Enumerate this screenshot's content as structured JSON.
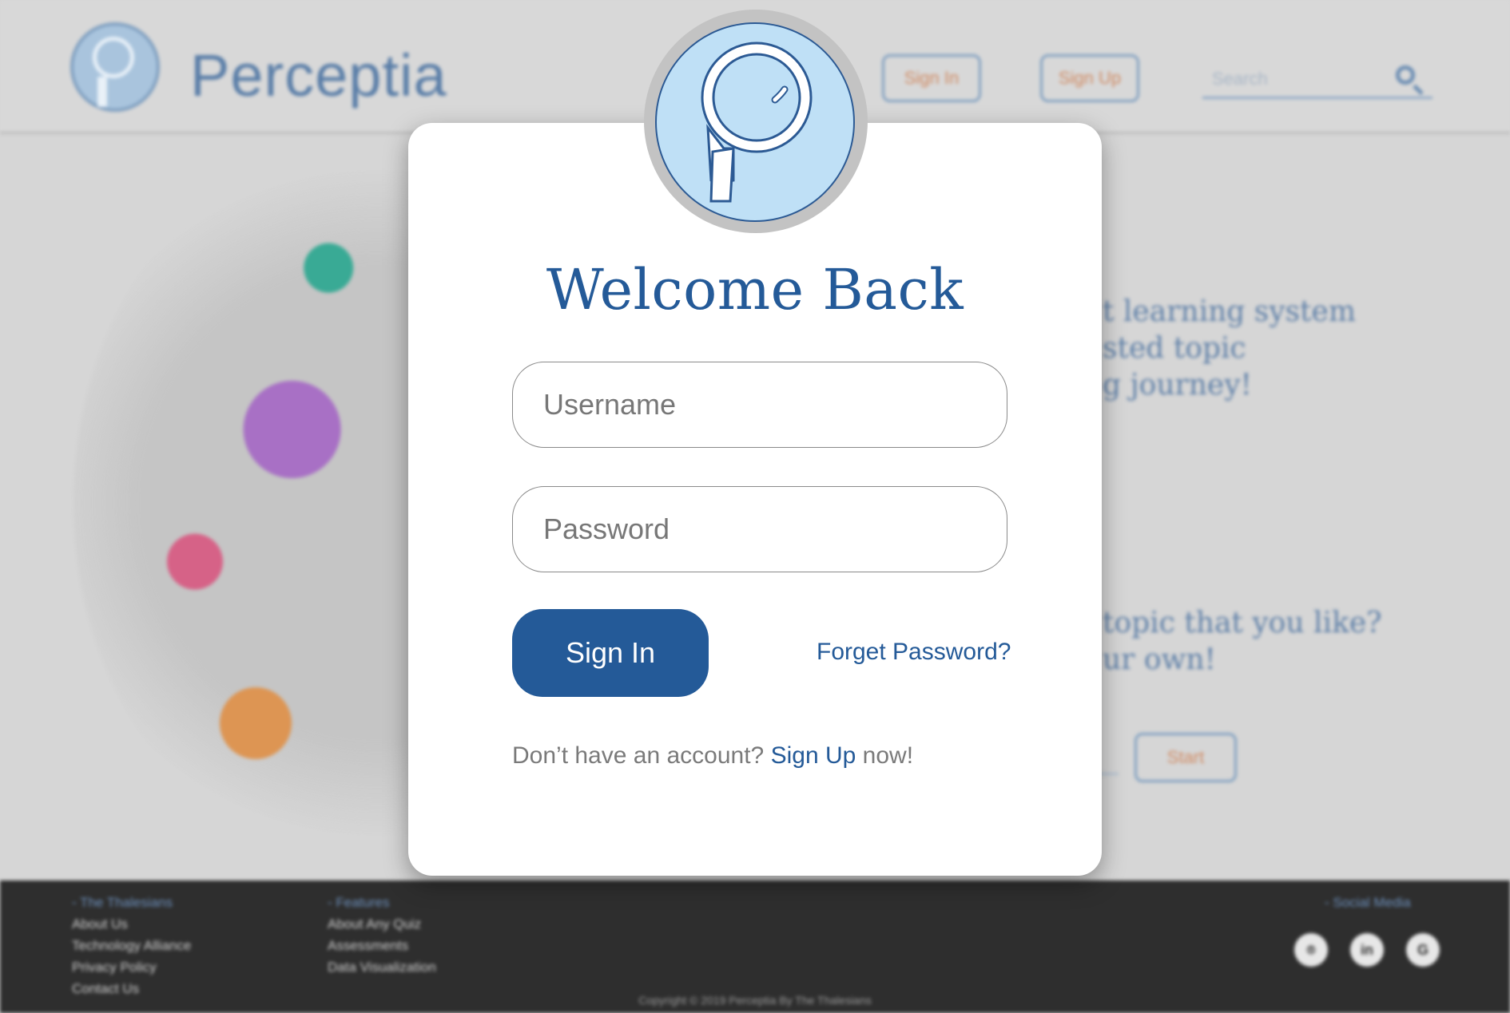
{
  "background": {
    "brand": "Perceptia",
    "header_buttons": {
      "sign_in": "Sign In",
      "sign_up": "Sign Up"
    },
    "search_placeholder": "Search",
    "intro_lines": [
      "t learning system",
      "sted topic",
      "g journey!"
    ],
    "prompt_lines": [
      "topic that you like?",
      "ur own!"
    ],
    "start_button": "Start",
    "footer": {
      "col1_heading": "- The Thalesians",
      "col1_links": [
        "About Us",
        "Technology Alliance",
        "Privacy Policy",
        "Contact Us"
      ],
      "col2_heading": "- Features",
      "col2_links": [
        "About Any Quiz",
        "Assessments",
        "Data Visualization"
      ],
      "social_heading": "- Social Media",
      "social_icons": [
        "github-icon",
        "linkedin-icon",
        "google-icon"
      ],
      "copyright": "Copyright © 2019 Perceptia By The Thalesians"
    }
  },
  "modal": {
    "title": "Welcome Back",
    "username_placeholder": "Username",
    "password_placeholder": "Password",
    "sign_in_label": "Sign In",
    "forget_password": "Forget Password?",
    "signup_prefix": "Don’t have an account?",
    "signup_link": "Sign Up",
    "signup_suffix": "now!"
  },
  "colors": {
    "primary": "#245a98",
    "accent": "#d08a62",
    "logo_fill": "#bfe0f6"
  }
}
